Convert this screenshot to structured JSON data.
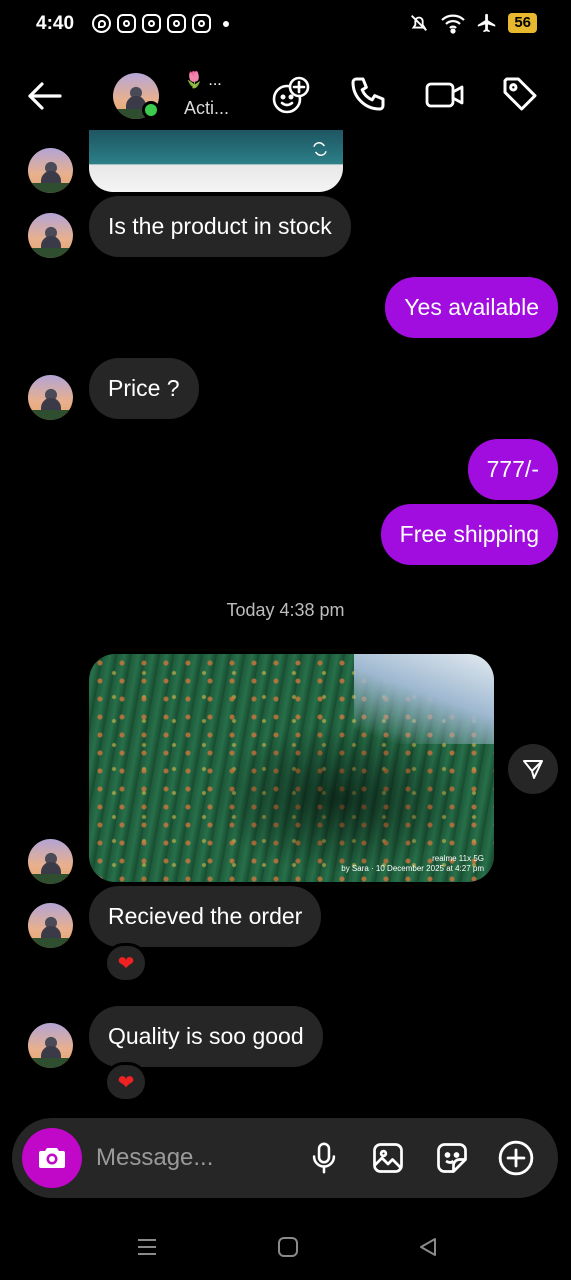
{
  "status_bar": {
    "time": "4:40",
    "battery": "56",
    "icons": [
      "whatsapp-icon",
      "instagram-icon",
      "instagram-icon",
      "instagram-icon",
      "instagram-icon",
      "mute-icon",
      "wifi-icon",
      "airplane-icon"
    ]
  },
  "header": {
    "name": "🌷 ...",
    "status": "Acti...",
    "icons": [
      "back-arrow-icon",
      "sticker-add-icon",
      "phone-icon",
      "video-icon",
      "tag-icon"
    ]
  },
  "messages": [
    {
      "side": "in",
      "text": "Is the product in stock"
    },
    {
      "side": "out",
      "text": "Yes available"
    },
    {
      "side": "in",
      "text": "Price ?"
    },
    {
      "side": "out",
      "text": "777/-"
    },
    {
      "side": "out",
      "text": "Free shipping"
    },
    {
      "side": "in",
      "text": "Recieved the order",
      "reaction": "❤"
    },
    {
      "side": "in",
      "text": "Quality is soo good",
      "reaction": "❤"
    }
  ],
  "timestamp": "Today 4:38 pm",
  "image_watermark": {
    "line1": "realme 11x 5G",
    "line2": "by Sara · 10 December 2025 at 4:27 pm"
  },
  "composer": {
    "placeholder": "Message...",
    "icons": [
      "camera-icon",
      "microphone-icon",
      "gallery-icon",
      "sticker-icon",
      "plus-icon"
    ]
  },
  "colors": {
    "outgoing_bubble": "#a10cdf",
    "incoming_bubble": "#262626",
    "camera_button": "#c107c7",
    "online": "#3ccb4c",
    "battery": "#e8b92e"
  }
}
